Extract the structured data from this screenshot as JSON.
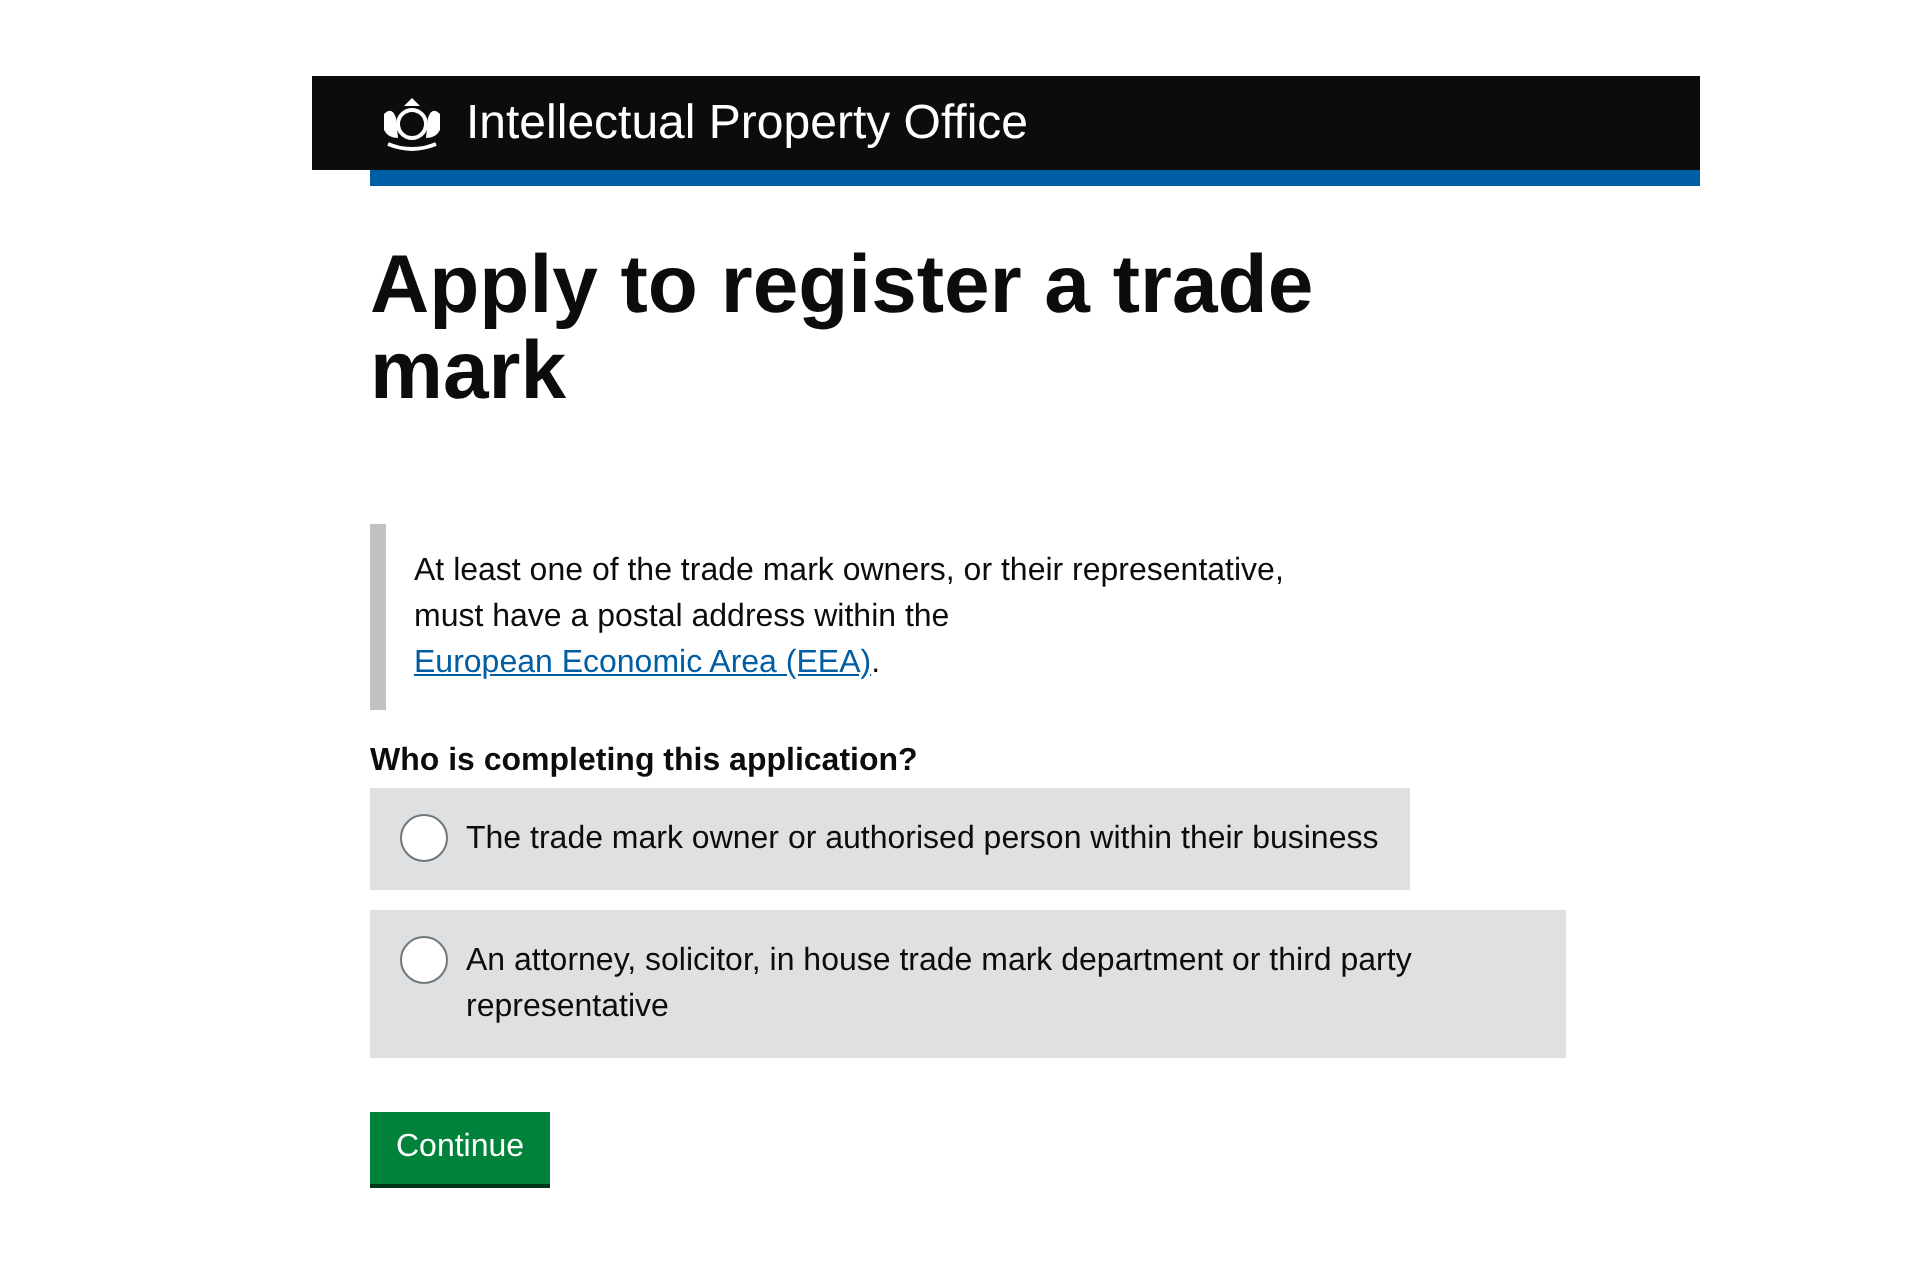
{
  "header": {
    "title": "Intellectual Property Office"
  },
  "heading": "Apply to register a trade mark",
  "notice": {
    "text_before": "At least one of the trade mark owners, or their representative, must have a postal address within the ",
    "link": "European Economic Area (EEA)",
    "text_after": "."
  },
  "question": {
    "legend": "Who is completing this application?",
    "options": [
      {
        "label": "The trade mark owner or authorised person within their business",
        "selected": false
      },
      {
        "label": "An attorney, solicitor, in house trade mark department or third party representative",
        "selected": false
      }
    ]
  },
  "buttons": [
    "Continue"
  ]
}
